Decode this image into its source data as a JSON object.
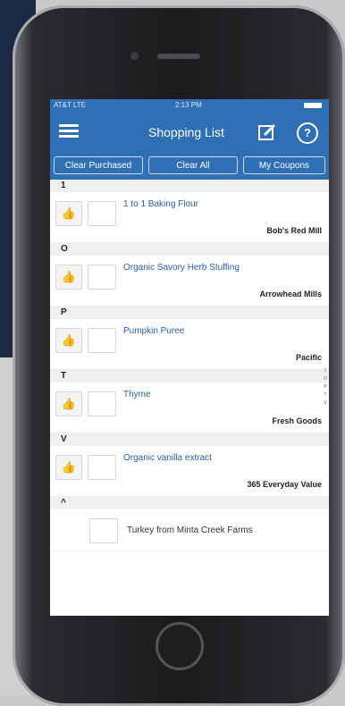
{
  "status": {
    "carrier": "AT&T LTE",
    "time": "2:13 PM"
  },
  "nav": {
    "title": "Shopping List"
  },
  "toolbar": {
    "clear_purchased": "Clear Purchased",
    "clear_all": "Clear All",
    "my_coupons": "My Coupons"
  },
  "list": {
    "sections": [
      {
        "letter": "1",
        "item": "1 to 1 Baking Flour",
        "brand": "Bob's Red Mill"
      },
      {
        "letter": "O",
        "item": "Organic Savory Herb Stuffing",
        "brand": "Arrowhead Mills"
      },
      {
        "letter": "P",
        "item": "Pumpkin Puree",
        "brand": "Pacific"
      },
      {
        "letter": "T",
        "item": "Thyme",
        "brand": "Fresh Goods"
      },
      {
        "letter": "V",
        "item": "Organic vanilla extract",
        "brand": "365 Everyday Value"
      }
    ],
    "other_letter": "^",
    "other_item": "Turkey from Minta Creek Farms"
  },
  "index": "1 O P T V",
  "icons": [
    "menu-icon",
    "edit-icon",
    "help-icon",
    "thumb-icon"
  ],
  "colors": {
    "accent": "#2f6fb5",
    "item_text": "#2a5fa5"
  }
}
